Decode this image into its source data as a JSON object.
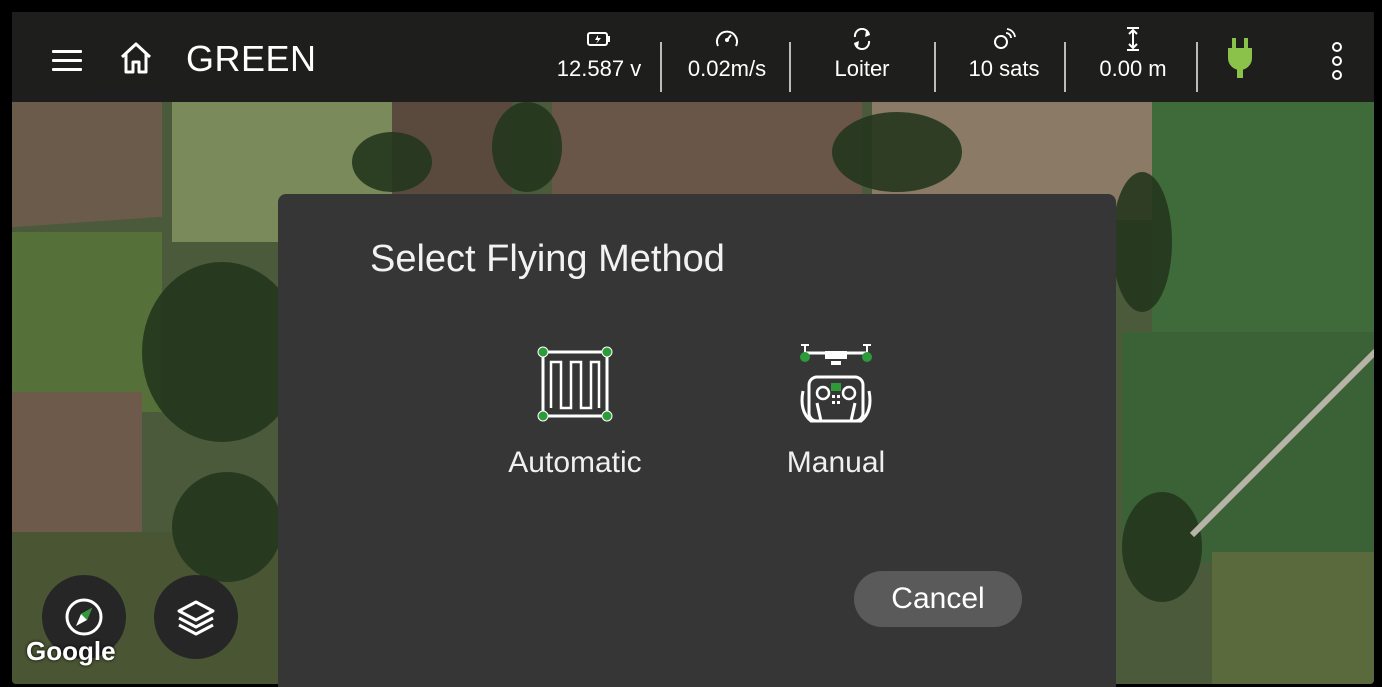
{
  "header": {
    "vehicle_name": "GREEN",
    "stats": {
      "battery": {
        "value": "12.587 v",
        "icon": "battery-icon"
      },
      "speed": {
        "value": "0.02m/s",
        "icon": "speedometer-icon"
      },
      "mode": {
        "value": "Loiter",
        "icon": "mode-cycle-icon"
      },
      "gps": {
        "value": "10 sats",
        "icon": "satellite-icon"
      },
      "altitude": {
        "value": "0.00 m",
        "icon": "altitude-icon"
      }
    },
    "connection_color": "#8bc34a"
  },
  "dialog": {
    "title": "Select Flying Method",
    "methods": [
      {
        "label": "Automatic",
        "icon": "grid-path-icon"
      },
      {
        "label": "Manual",
        "icon": "remote-controller-icon"
      }
    ],
    "cancel_label": "Cancel"
  },
  "map": {
    "attribution": "Google"
  },
  "colors": {
    "accent": "#2e9b3a",
    "dialog_bg": "#363636",
    "topbar_bg": "#1c1c1c"
  }
}
